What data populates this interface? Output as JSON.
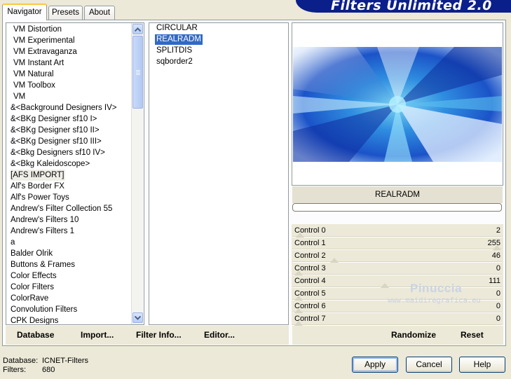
{
  "tabs": [
    {
      "label": "Navigator",
      "active": true
    },
    {
      "label": "Presets",
      "active": false
    },
    {
      "label": "About",
      "active": false
    }
  ],
  "banner_title": "Filters Unlimited 2.0",
  "categories": [
    "VM Distortion",
    "VM Experimental",
    "VM Extravaganza",
    "VM Instant Art",
    "VM Natural",
    "VM Toolbox",
    "VM",
    "&<Background Designers IV>",
    "&<BKg Designer sf10 I>",
    "&<BKg Designer sf10 II>",
    "&<BKg Designer sf10 III>",
    "&<Bkg Designers sf10 IV>",
    "&<Bkg Kaleidoscope>",
    "[AFS IMPORT]",
    "Alf's Border FX",
    "Alf's Power Toys",
    "Andrew's Filter Collection 55",
    "Andrew's Filters 10",
    "Andrew's Filters 1",
    "a",
    "Balder Olrik",
    "Buttons & Frames",
    "Color Effects",
    "Color Filters",
    "ColorRave",
    "Convolution Filters",
    "CPK Designs"
  ],
  "selected_category": "[AFS IMPORT]",
  "filters": [
    "CIRCULAR",
    "REALRADM",
    "SPLITDIS",
    "sqborder2"
  ],
  "selected_filter": "REALRADM",
  "preview_filter_name": "REALRADM",
  "progress": 0,
  "controls": [
    {
      "label": "Control 0",
      "value": "2"
    },
    {
      "label": "Control 1",
      "value": "255"
    },
    {
      "label": "Control 2",
      "value": "46"
    },
    {
      "label": "Control 3",
      "value": "0"
    },
    {
      "label": "Control 4",
      "value": "111"
    },
    {
      "label": "Control 5",
      "value": "0"
    },
    {
      "label": "Control 6",
      "value": "0"
    },
    {
      "label": "Control 7",
      "value": "0"
    }
  ],
  "watermark": {
    "name": "Pinuccia",
    "site": "www.maidiregrafica.eu"
  },
  "toolbar": {
    "database": "Database",
    "import": "Import...",
    "filter_info": "Filter Info...",
    "editor": "Editor...",
    "randomize": "Randomize",
    "reset": "Reset"
  },
  "status": {
    "database_label": "Database:",
    "database_value": "ICNET-Filters",
    "filters_label": "Filters:",
    "filters_value": "680"
  },
  "buttons": {
    "apply": "Apply",
    "cancel": "Cancel",
    "help": "Help"
  },
  "colors": {
    "selection": "#316ac5",
    "banner": "#0b1f8a",
    "dialog_bg": "#ece9d8"
  }
}
